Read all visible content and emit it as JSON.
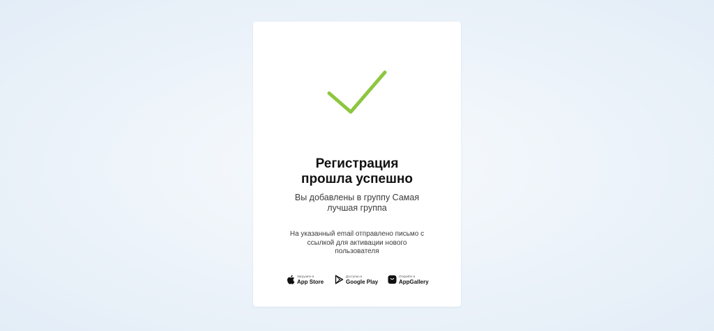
{
  "colors": {
    "accent": "#8dc63f",
    "card": "#ffffff",
    "background": "#eaf1f8"
  },
  "success": {
    "icon": "checkmark-icon",
    "title_line1": "Регистрация",
    "title_line2": "прошла успешно",
    "subtitle_line1": "Вы добавлены в группу Самая",
    "subtitle_line2": "лучшая группа",
    "note_line1": "На указанный email отправлено письмо с",
    "note_line2": "ссылкой для активации нового",
    "note_line3": "пользователя"
  },
  "stores": [
    {
      "icon": "apple-icon",
      "small": "Загрузите в",
      "label": "App Store"
    },
    {
      "icon": "google-play-icon",
      "small": "Доступно в",
      "label": "Google Play"
    },
    {
      "icon": "appgallery-icon",
      "small": "Откройте в",
      "label": "AppGallery"
    }
  ]
}
